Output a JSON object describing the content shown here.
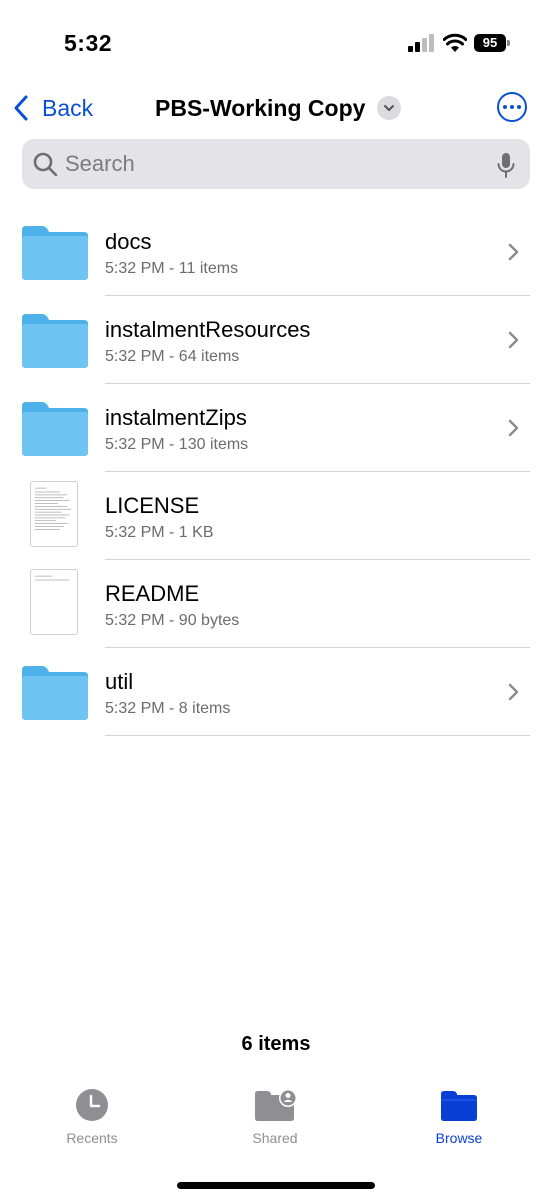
{
  "status_bar": {
    "time": "5:32",
    "battery_level": "95"
  },
  "nav": {
    "back_label": "Back",
    "title": "PBS-Working Copy"
  },
  "search": {
    "placeholder": "Search"
  },
  "files": [
    {
      "name": "docs",
      "meta": "5:32 PM - 11 items",
      "kind": "folder"
    },
    {
      "name": "instalmentResources",
      "meta": "5:32 PM - 64 items",
      "kind": "folder"
    },
    {
      "name": "instalmentZips",
      "meta": "5:32 PM - 130 items",
      "kind": "folder"
    },
    {
      "name": "LICENSE",
      "meta": "5:32 PM - 1 KB",
      "kind": "document"
    },
    {
      "name": "README",
      "meta": "5:32 PM - 90 bytes",
      "kind": "document"
    },
    {
      "name": "util",
      "meta": "5:32 PM - 8 items",
      "kind": "folder"
    }
  ],
  "footer": {
    "item_count": "6 items"
  },
  "tabs": [
    {
      "label": "Recents",
      "icon": "clock-icon",
      "active": false
    },
    {
      "label": "Shared",
      "icon": "shared-folder-icon",
      "active": false
    },
    {
      "label": "Browse",
      "icon": "folder-icon",
      "active": true
    }
  ],
  "colors": {
    "accent": "#0a4fd6",
    "folder": "#5ab9f0",
    "secondary_text": "#6b6b70"
  }
}
